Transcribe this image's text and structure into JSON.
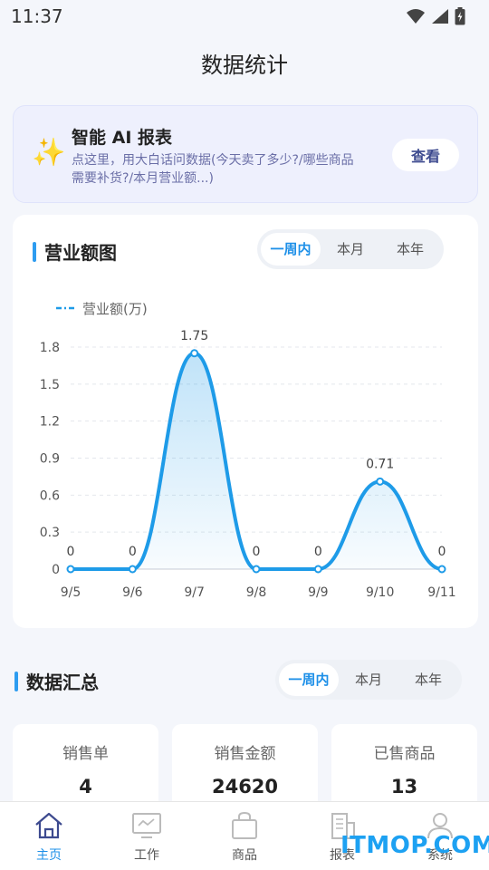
{
  "status_bar": {
    "time": "11:37"
  },
  "page": {
    "title": "数据统计"
  },
  "ai_card": {
    "icon": "sparkles-icon",
    "title": "智能 AI 报表",
    "desc_line1": "点这里，用大白话问数据(今天卖了多少?/哪些商品",
    "desc_line2": "需要补货?/本月营业额...)",
    "button": "查看"
  },
  "revenue": {
    "title": "营业额图",
    "tabs": [
      "一周内",
      "本月",
      "本年"
    ],
    "active_tab": 0
  },
  "chart_data": {
    "type": "line",
    "smooth": true,
    "area_fill": true,
    "categories": [
      "9/5",
      "9/6",
      "9/7",
      "9/8",
      "9/9",
      "9/10",
      "9/11"
    ],
    "series": [
      {
        "name": "营业额(万)",
        "values": [
          0,
          0,
          1.75,
          0,
          0,
          0.71,
          0
        ]
      }
    ],
    "data_labels": [
      "0",
      "0",
      "1.75",
      "0",
      "0",
      "0.71",
      "0"
    ],
    "y_ticks": [
      "0",
      "0.3",
      "0.6",
      "0.9",
      "1.2",
      "1.5",
      "1.8"
    ],
    "ylim": [
      0,
      1.8
    ],
    "grid": true,
    "legend_position": "top-left",
    "line_color": "#1e9be8"
  },
  "summary": {
    "title": "数据汇总",
    "tabs": [
      "一周内",
      "本月",
      "本年"
    ],
    "active_tab": 0,
    "stats": [
      {
        "label": "销售单",
        "value": "4"
      },
      {
        "label": "销售金额",
        "value": "24620"
      },
      {
        "label": "已售商品",
        "value": "13"
      }
    ]
  },
  "tabbar": {
    "items": [
      {
        "label": "主页",
        "icon": "home-icon",
        "active": true
      },
      {
        "label": "工作",
        "icon": "monitor-icon",
        "active": false
      },
      {
        "label": "商品",
        "icon": "shopping-bag-icon",
        "active": false
      },
      {
        "label": "报表",
        "icon": "report-building-icon",
        "active": false
      },
      {
        "label": "系统",
        "icon": "user-icon",
        "active": false
      }
    ]
  },
  "watermark": "ITMOP.COM"
}
